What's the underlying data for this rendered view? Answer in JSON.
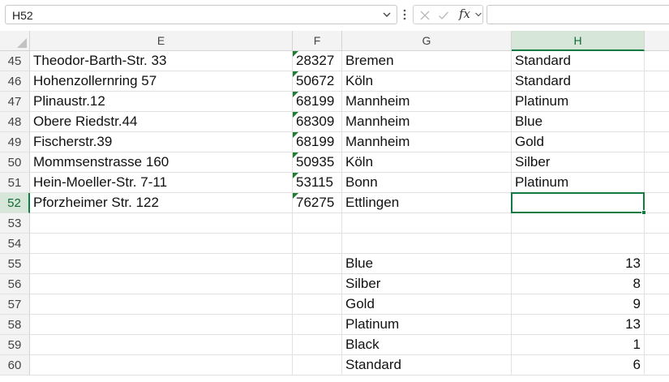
{
  "formula_bar": {
    "name_box": "H52",
    "fx": "fx",
    "formula": ""
  },
  "columns": [
    {
      "label": "E",
      "width": 324
    },
    {
      "label": "F",
      "width": 61
    },
    {
      "label": "G",
      "width": 209
    },
    {
      "label": "H",
      "width": 164
    }
  ],
  "active_column": "H",
  "active_row": "52",
  "rows": [
    {
      "n": "45",
      "cells": [
        "Theodor-Barth-Str. 33",
        "28327",
        "Bremen",
        "Standard"
      ]
    },
    {
      "n": "46",
      "cells": [
        "Hohenzollernring 57",
        "50672",
        "Köln",
        "Standard"
      ]
    },
    {
      "n": "47",
      "cells": [
        "Plinaustr.12",
        "68199",
        "Mannheim",
        "Platinum"
      ]
    },
    {
      "n": "48",
      "cells": [
        "Obere Riedstr.44",
        "68309",
        "Mannheim",
        "Blue"
      ]
    },
    {
      "n": "49",
      "cells": [
        "Fischerstr.39",
        "68199",
        "Mannheim",
        "Gold"
      ]
    },
    {
      "n": "50",
      "cells": [
        "Mommsenstrasse 160",
        "50935",
        "Köln",
        "Silber"
      ]
    },
    {
      "n": "51",
      "cells": [
        "Hein-Moeller-Str. 7-11",
        "53115",
        "Bonn",
        "Platinum"
      ]
    },
    {
      "n": "52",
      "cells": [
        "Pforzheimer Str. 122",
        "76275",
        "Ettlingen",
        ""
      ]
    },
    {
      "n": "53",
      "cells": [
        "",
        "",
        "",
        ""
      ]
    },
    {
      "n": "54",
      "cells": [
        "",
        "",
        "",
        ""
      ]
    },
    {
      "n": "55",
      "cells": [
        "",
        "",
        "Blue",
        "13"
      ]
    },
    {
      "n": "56",
      "cells": [
        "",
        "",
        "Silber",
        "8"
      ]
    },
    {
      "n": "57",
      "cells": [
        "",
        "",
        "Gold",
        "9"
      ]
    },
    {
      "n": "58",
      "cells": [
        "",
        "",
        "Platinum",
        "13"
      ]
    },
    {
      "n": "59",
      "cells": [
        "",
        "",
        "Black",
        "1"
      ]
    },
    {
      "n": "60",
      "cells": [
        "",
        "",
        "Standard",
        "6"
      ]
    }
  ]
}
